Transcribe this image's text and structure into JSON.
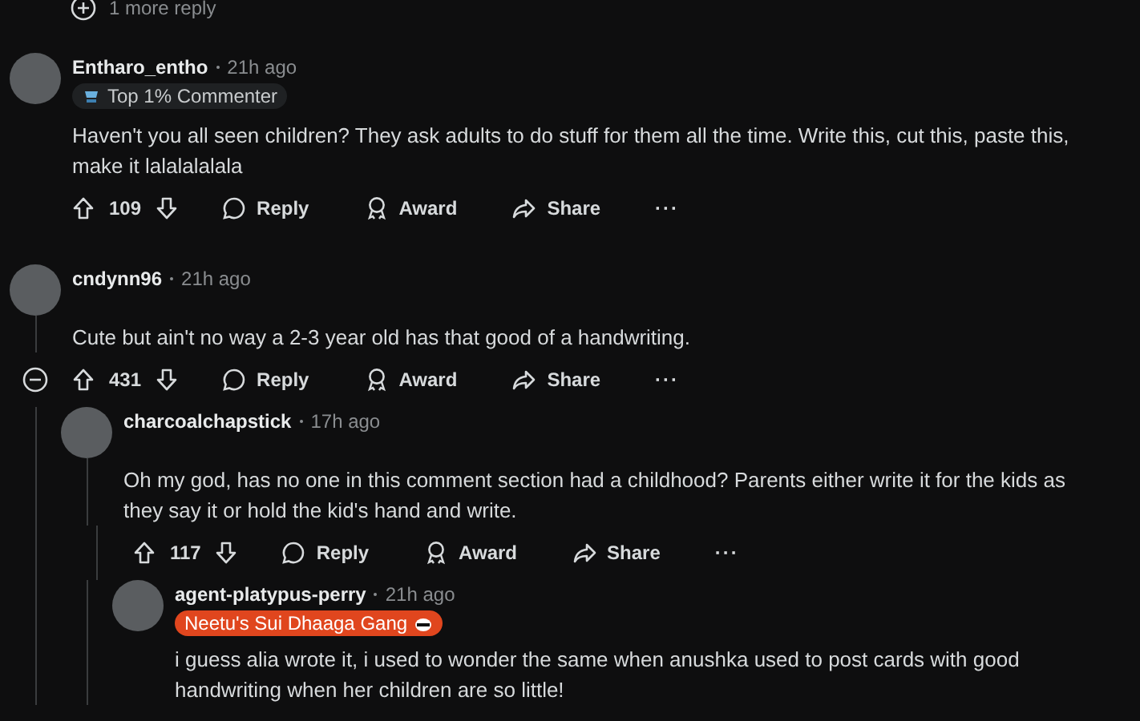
{
  "more_replies": {
    "label": "1 more reply"
  },
  "comments": [
    {
      "author": "Entharo_entho",
      "time": "21h ago",
      "flair": {
        "kind": "achievement",
        "text": "Top 1% Commenter"
      },
      "body": "Haven't you all seen children? They ask adults to do stuff for them all the time. Write this, cut this, paste this, make it lalalalalala",
      "votes": "109",
      "actions": [
        "Reply",
        "Award",
        "Share",
        "···"
      ]
    },
    {
      "author": "cndynn96",
      "time": "21h ago",
      "body": "Cute but ain't no way a 2-3 year old has that good of a handwriting.",
      "votes": "431",
      "expanded": true,
      "actions": [
        "Reply",
        "Award",
        "Share",
        "···"
      ],
      "children": [
        {
          "author": "charcoalchapstick",
          "time": "17h ago",
          "body": "Oh my god, has no one in this comment section had a childhood? Parents either write it for the kids as they say it or hold the kid's hand and write.",
          "votes": "117",
          "actions": [
            "Reply",
            "Award",
            "Share",
            "···"
          ],
          "children": [
            {
              "author": "agent-platypus-perry",
              "time": "21h ago",
              "flair": {
                "kind": "user",
                "text": "Neetu's Sui Dhaaga Gang",
                "color": "#e0461e"
              },
              "body": "i guess alia wrote it, i used to wonder the same when anushka used to post cards with good handwriting when her children are so little!"
            }
          ]
        }
      ]
    }
  ]
}
